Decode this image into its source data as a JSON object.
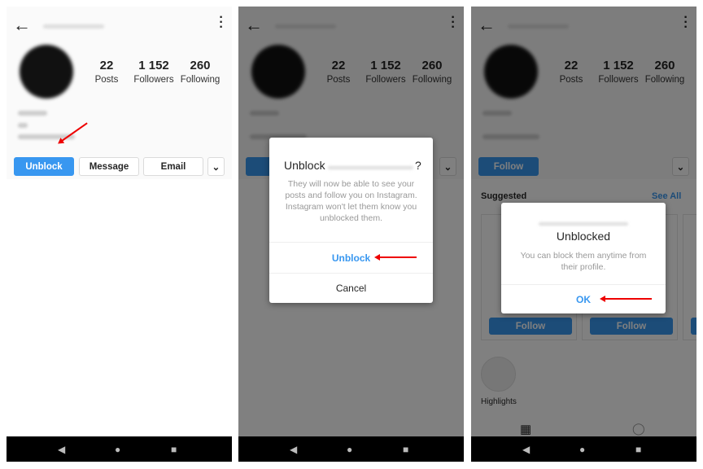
{
  "profile": {
    "stats": [
      {
        "value": "22",
        "label": "Posts"
      },
      {
        "value": "1 152",
        "label": "Followers"
      },
      {
        "value": "260",
        "label": "Following"
      }
    ],
    "buttons": {
      "unblock": "Unblock",
      "follow": "Follow",
      "message": "Message",
      "email": "Email"
    }
  },
  "dialog_unblock": {
    "title_prefix": "Unblock",
    "title_suffix": "?",
    "message": "They will now be able to see your posts and follow you on Instagram. Instagram won't let them know you unblocked them.",
    "confirm": "Unblock",
    "cancel": "Cancel"
  },
  "dialog_unblocked": {
    "title": "Unblocked",
    "message": "You can block them anytime from their profile.",
    "ok": "OK"
  },
  "suggested": {
    "title": "Suggested",
    "see_all": "See All",
    "follow": "Follow"
  },
  "highlights": "Highlights",
  "colors": {
    "accent": "#3897f0",
    "annotation_arrow": "#e00000"
  },
  "icons": [
    "back-arrow-icon",
    "kebab-menu-icon",
    "chevron-down-icon",
    "nav-back-icon",
    "nav-home-icon",
    "nav-recents-icon",
    "grid-icon",
    "tagged-icon",
    "close-icon"
  ]
}
